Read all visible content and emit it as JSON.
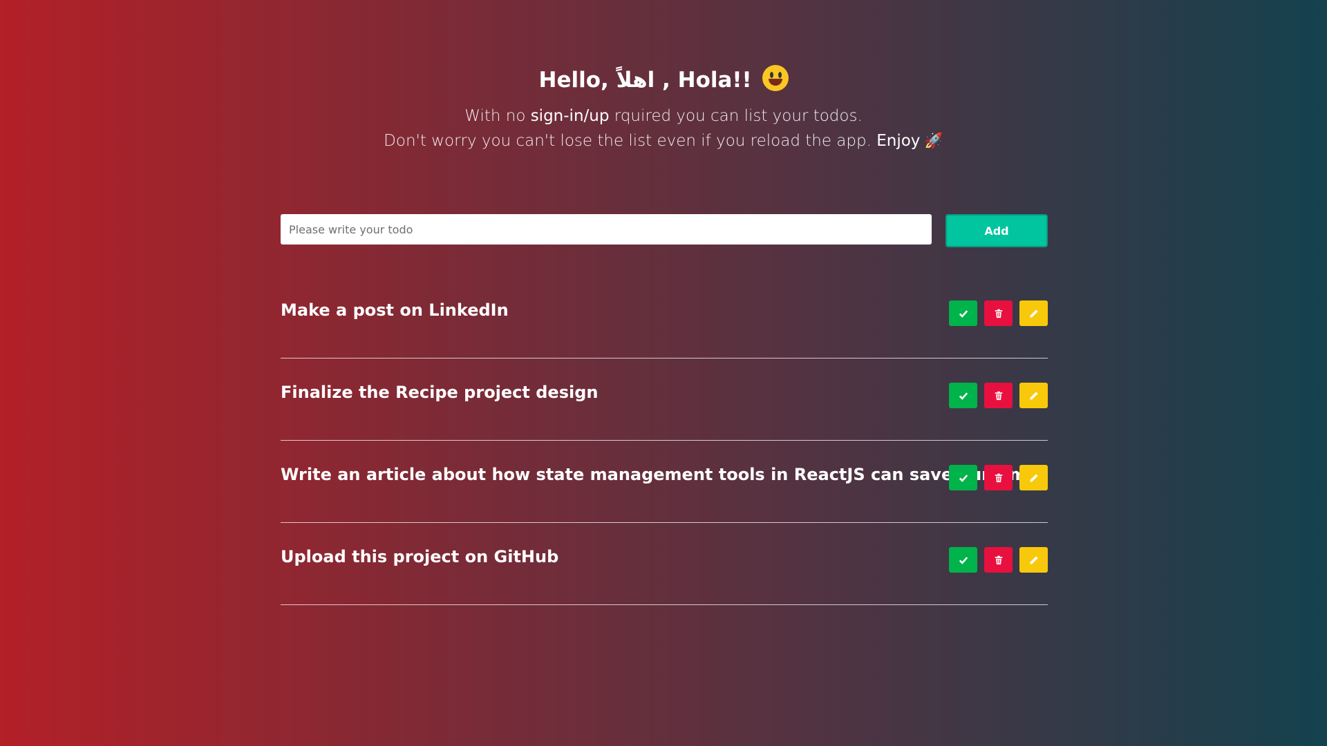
{
  "header": {
    "greeting_prefix": "Hello, ",
    "greeting_arabic": "اهلاً",
    "greeting_suffix": " , Hola!!",
    "smile_icon": "smiley-face-icon",
    "intro_line1_a": "With no ",
    "intro_line1_b": "sign-in/up",
    "intro_line1_c": " rquired you can list your todos.",
    "intro_line2_a": "Don't worry you can't lose the list even if you reload the app. ",
    "intro_line2_b": "Enjoy",
    "rocket_glyph": "🚀"
  },
  "form": {
    "placeholder": "Please write your todo",
    "value": "",
    "add_label": "Add"
  },
  "todos": [
    {
      "text": "Make a post on LinkedIn"
    },
    {
      "text": "Finalize the Recipe project design"
    },
    {
      "text": "Write an article about how state management tools in ReactJS can save our time"
    },
    {
      "text": "Upload this project on GitHub"
    }
  ],
  "icons": {
    "done": "check-icon",
    "delete": "trash-icon",
    "edit": "pencil-icon"
  },
  "colors": {
    "accent": "#00c59e",
    "done": "#00b34a",
    "delete": "#e8103f",
    "edit": "#f8c90a"
  }
}
